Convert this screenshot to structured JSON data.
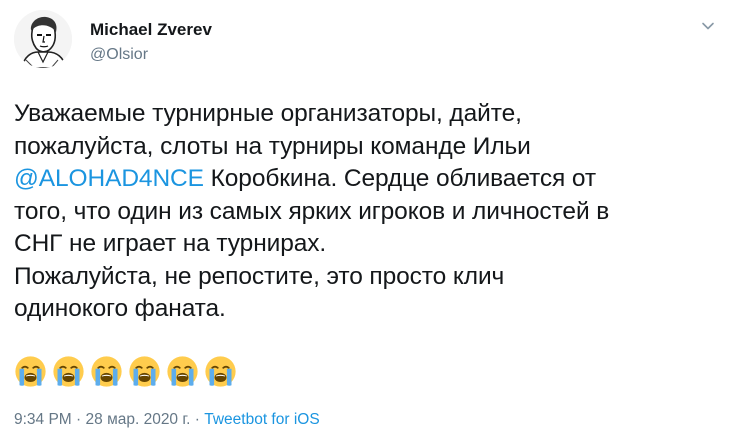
{
  "author": {
    "name": "Michael Zverev",
    "handle": "@Olsior"
  },
  "tweet": {
    "line1": "Уважаемые турнирные организаторы, дайте,",
    "line2": "пожалуйста, слоты на турниры команде Ильи",
    "mention": "@ALOHAD4NCE",
    "line3_rest": " Коробкина. Сердце обливается от",
    "line4": "того, что один из самых ярких игроков и личностей в",
    "line5": "СНГ не играет на турнирах.",
    "line6": "Пожалуйста, не репостите, это просто клич",
    "line7": "одинокого фаната.",
    "emojis": [
      "loudly-crying-face",
      "loudly-crying-face",
      "loudly-crying-face",
      "loudly-crying-face",
      "loudly-crying-face",
      "loudly-crying-face"
    ]
  },
  "meta": {
    "time": "9:34 PM",
    "separator1": " · ",
    "date": "28 мар. 2020 г.",
    "separator2": " · ",
    "source": "Tweetbot for iOS"
  },
  "icons": {
    "menu": "chevron-down-icon",
    "avatar": "avatar"
  },
  "colors": {
    "link": "#1b95e0",
    "secondary_text": "#657786",
    "primary_text": "#14171a"
  }
}
